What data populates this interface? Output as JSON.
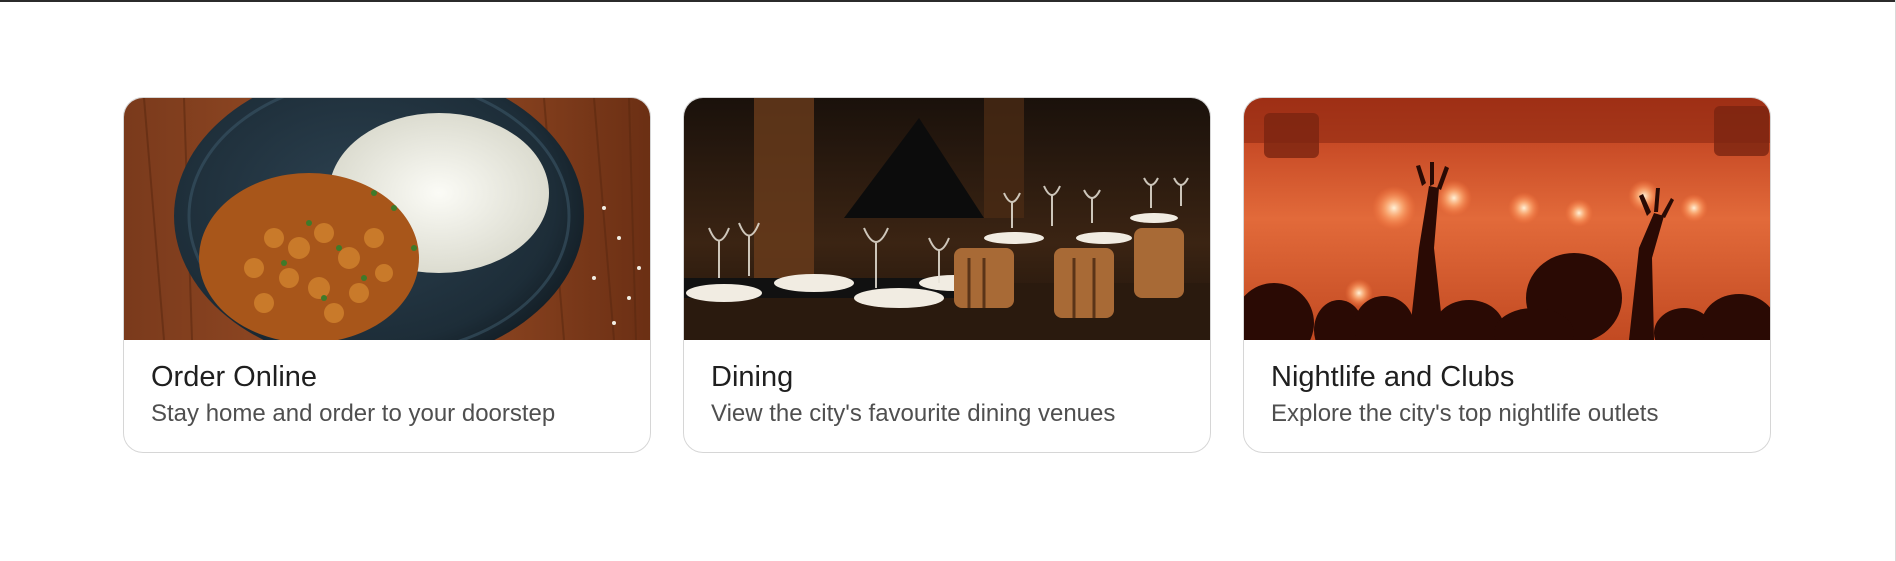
{
  "cards": [
    {
      "title": "Order Online",
      "subtitle": "Stay home and order to your doorstep",
      "image": "food-plate-image"
    },
    {
      "title": "Dining",
      "subtitle": "View the city's favourite dining venues",
      "image": "restaurant-interior-image"
    },
    {
      "title": "Nightlife and Clubs",
      "subtitle": "Explore the city's top nightlife outlets",
      "image": "nightclub-crowd-image"
    }
  ],
  "colors": {
    "title": "#1f1f1f",
    "subtitle": "#4f4f4f",
    "border": "#d6d6d6"
  }
}
